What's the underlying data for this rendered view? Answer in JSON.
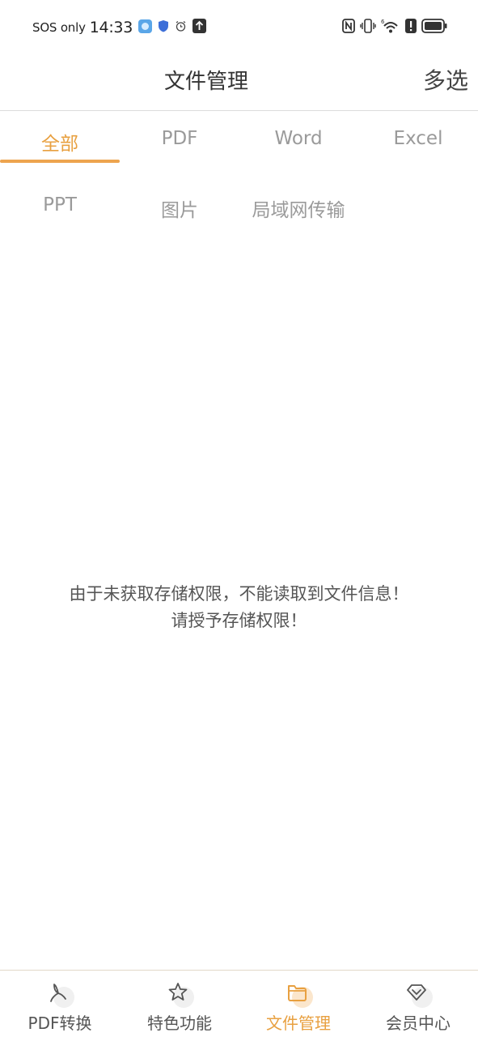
{
  "status_bar": {
    "carrier": "SOS only",
    "time": "14:33",
    "icons": [
      "app-icon",
      "shield-icon",
      "alarm-icon",
      "upload-icon",
      "nfc-icon",
      "vibrate-icon",
      "wifi-icon",
      "alert-icon",
      "battery-icon"
    ]
  },
  "header": {
    "title": "文件管理",
    "multi_select": "多选"
  },
  "tabs": [
    {
      "label": "全部",
      "active": true
    },
    {
      "label": "PDF",
      "active": false
    },
    {
      "label": "Word",
      "active": false
    },
    {
      "label": "Excel",
      "active": false
    },
    {
      "label": "PPT",
      "active": false
    },
    {
      "label": "图片",
      "active": false
    },
    {
      "label": "局域网传输",
      "active": false
    }
  ],
  "message": {
    "line1": "由于未获取存储权限，不能读取到文件信息！",
    "line2": "请授予存储权限！"
  },
  "bottom_nav": [
    {
      "label": "PDF转换",
      "icon": "pdf-icon",
      "active": false
    },
    {
      "label": "特色功能",
      "icon": "star-icon",
      "active": false
    },
    {
      "label": "文件管理",
      "icon": "folder-icon",
      "active": true
    },
    {
      "label": "会员中心",
      "icon": "diamond-icon",
      "active": false
    }
  ],
  "colors": {
    "accent": "#e8a040",
    "inactive_tab": "#9a9a9a"
  }
}
